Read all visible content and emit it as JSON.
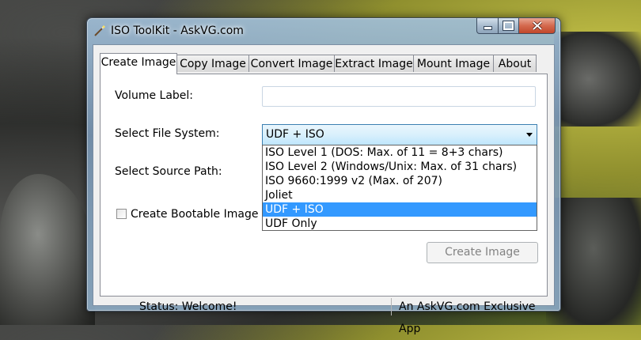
{
  "window": {
    "title": "ISO ToolKit - AskVG.com"
  },
  "tabs": [
    {
      "label": "Create Image",
      "active": true
    },
    {
      "label": "Copy Image",
      "active": false
    },
    {
      "label": "Convert Image",
      "active": false
    },
    {
      "label": "Extract Image",
      "active": false
    },
    {
      "label": "Mount Image",
      "active": false
    },
    {
      "label": "About",
      "active": false
    }
  ],
  "form": {
    "volume_label": "Volume Label:",
    "volume_value": "",
    "file_system_label": "Select File System:",
    "file_system_selected": "UDF + ISO",
    "file_system_options": [
      "ISO Level 1 (DOS: Max. of 11 = 8+3 chars)",
      "ISO Level 2 (Windows/Unix: Max. of 31 chars)",
      "ISO 9660:1999 v2 (Max. of 207)",
      "Joliet",
      "UDF + ISO",
      "UDF Only"
    ],
    "source_path_label": "Select Source Path:",
    "bootable_label": "Create Bootable Image",
    "bootable_checked": false,
    "create_button": "Create Image"
  },
  "status": {
    "left": "Status: Welcome!",
    "right": "An AskVG.com Exclusive App"
  },
  "colors": {
    "selection": "#3399ff",
    "combo_border": "#3c7fb1"
  }
}
